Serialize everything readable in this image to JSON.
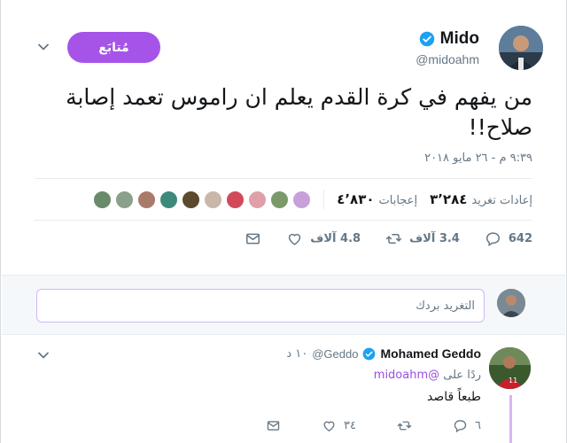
{
  "colors": {
    "accent": "#a654e8",
    "verified": "#1da1f2",
    "muted": "#657786"
  },
  "tweet": {
    "author_name": "Mido",
    "author_handle": "@midoahm",
    "follow_label": "مُتابَع",
    "text": "من يفهم في كرة القدم يعلم ان راموس تعمد إصابة صلاح!!",
    "timestamp": "٩:٣٩ م - ٢٦ مايو ٢٠١٨",
    "retweets_count": "٣٬٢٨٤",
    "retweets_label": "إعادات تغريد",
    "likes_count": "٤٬٨٣٠",
    "likes_label": "إعجابات",
    "actions": {
      "reply_count": "642",
      "retweet_count": "3.4 آلاف",
      "like_count": "4.8 آلاف"
    },
    "likers": [
      "#c7a0d9",
      "#7a9a6a",
      "#e0a0a8",
      "#d24a5a",
      "#c9b8a8",
      "#5b4a2e",
      "#3d8a7a",
      "#a87a6a",
      "#8aa08a",
      "#6a8a6a"
    ]
  },
  "reply_compose": {
    "placeholder": "التغريد بردك"
  },
  "reply": {
    "author_name": "Mohamed Geddo",
    "author_handle": "@Geddo",
    "time": "١٠ د",
    "replying_to_label": "ردًا على",
    "replying_to_handle": "@midoahm",
    "text": "طبعاً قاصد",
    "reply_count": "٦",
    "like_count": "٣٤"
  },
  "icons": [
    "verified-icon",
    "chevron-down-icon",
    "reply-icon",
    "retweet-icon",
    "like-icon",
    "message-icon"
  ]
}
